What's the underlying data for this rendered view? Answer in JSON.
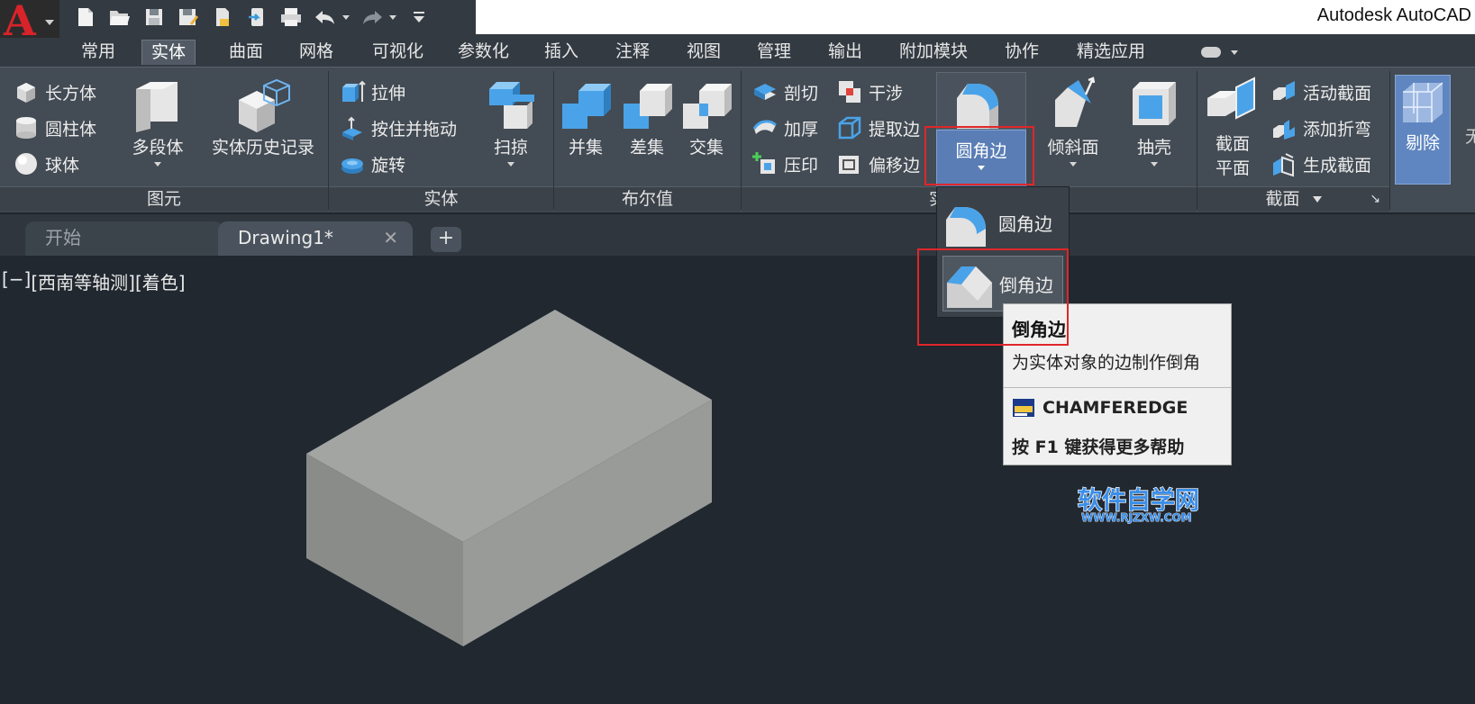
{
  "app": {
    "title": "Autodesk AutoCAD",
    "logo_letter": "A"
  },
  "quick_access": [
    "new-icon",
    "open-icon",
    "save-icon",
    "save-as-icon",
    "open-web-icon",
    "export-icon",
    "print-icon",
    "undo-icon",
    "redo-icon",
    "customize-icon"
  ],
  "ribbon_tabs": [
    {
      "label": "常用",
      "active": false
    },
    {
      "label": "实体",
      "active": true
    },
    {
      "label": "曲面",
      "active": false
    },
    {
      "label": "网格",
      "active": false
    },
    {
      "label": "可视化",
      "active": false
    },
    {
      "label": "参数化",
      "active": false
    },
    {
      "label": "插入",
      "active": false
    },
    {
      "label": "注释",
      "active": false
    },
    {
      "label": "视图",
      "active": false
    },
    {
      "label": "管理",
      "active": false
    },
    {
      "label": "输出",
      "active": false
    },
    {
      "label": "附加模块",
      "active": false
    },
    {
      "label": "协作",
      "active": false
    },
    {
      "label": "精选应用",
      "active": false
    }
  ],
  "panels": {
    "primitives": {
      "title": "图元",
      "box": "长方体",
      "cylinder": "圆柱体",
      "sphere": "球体",
      "polysolid": "多段体",
      "history": "实体历史记录"
    },
    "solid": {
      "title": "实体",
      "extrude": "拉伸",
      "presspull": "按住并拖动",
      "revolve": "旋转",
      "sweep": "扫掠"
    },
    "boolean": {
      "title": "布尔值",
      "union": "并集",
      "subtract": "差集",
      "intersect": "交集"
    },
    "solid_edit": {
      "title": "实",
      "slice": "剖切",
      "thicken": "加厚",
      "imprint": "压印",
      "interfere": "干涉",
      "extract_edges": "提取边",
      "offset_edges": "偏移边",
      "fillet_edge": "圆角边",
      "taper_faces": "倾斜面",
      "shell": "抽壳"
    },
    "section": {
      "title": "截面",
      "section_plane_line1": "截面",
      "section_plane_line2": "平面",
      "live_section": "活动截面",
      "add_jog": "添加折弯",
      "generate_section": "生成截面",
      "cull": "剔除",
      "cut_char": "无"
    }
  },
  "doc_tabs": {
    "start": "开始",
    "drawing": "Drawing1*",
    "close_glyph": "✕",
    "add_glyph": "+"
  },
  "viewport": {
    "controls": "[−]",
    "view": "[西南等轴测]",
    "style": "[着色]"
  },
  "flyout": {
    "fillet": "圆角边",
    "chamfer": "倒角边"
  },
  "tooltip": {
    "title": "倒角边",
    "description": "为实体对象的边制作倒角",
    "command": "CHAMFEREDGE",
    "help": "按 F1 键获得更多帮助"
  },
  "watermark": {
    "name": "软件自学网",
    "url": "WWW.RJZXW.COM"
  },
  "colors": {
    "ribbon_bg": "#434b54",
    "viewport_bg": "#212830",
    "highlight_blue": "#5a7db5",
    "red_outline": "#e0262a",
    "box_top": "#a3a5a3",
    "box_left": "#8a8c8a",
    "box_right": "#999b99"
  }
}
